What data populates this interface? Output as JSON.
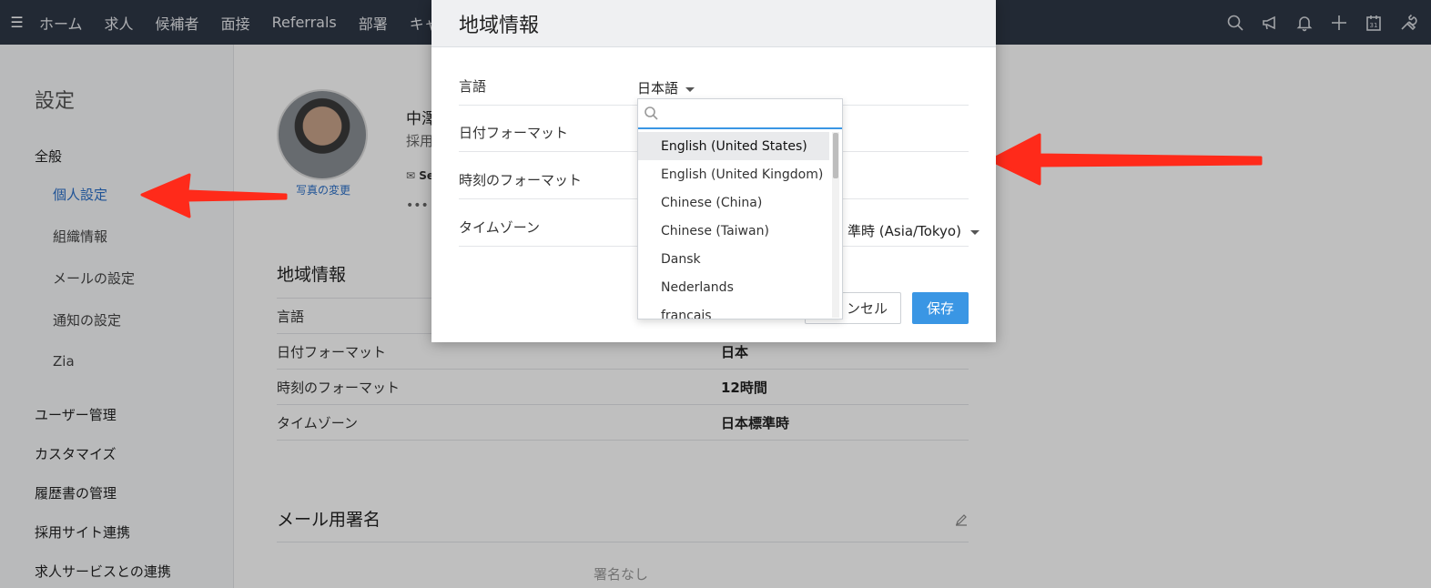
{
  "nav": {
    "items": [
      "ホーム",
      "求人",
      "候補者",
      "面接",
      "Referrals",
      "部署",
      "キャ"
    ],
    "icons": [
      "search-icon",
      "megaphone-icon",
      "bell-icon",
      "plus-icon",
      "calendar-icon",
      "tools-icon"
    ],
    "calendar_day": "31"
  },
  "sidebar": {
    "title": "設定",
    "general": "全般",
    "items": [
      "個人設定",
      "組織情報",
      "メールの設定",
      "通知の設定",
      "Zia"
    ],
    "sections": [
      "ユーザー管理",
      "カスタマイズ",
      "履歴書の管理",
      "採用サイト連携",
      "求人サービスとの連携"
    ]
  },
  "profile": {
    "photo_change": "写真の変更",
    "name": "中澤",
    "role": "採用",
    "mail": "Se",
    "more": "•••"
  },
  "locale_section": {
    "title": "地域情報",
    "rows": [
      {
        "label": "言語",
        "value": ""
      },
      {
        "label": "日付フォーマット",
        "value": "日本"
      },
      {
        "label": "時刻のフォーマット",
        "value": "12時間"
      },
      {
        "label": "タイムゾーン",
        "value": "日本標準時"
      }
    ]
  },
  "signature_section": {
    "title": "メール用署名",
    "empty": "署名なし"
  },
  "modal": {
    "title": "地域情報",
    "labels": [
      "言語",
      "日付フォーマット",
      "時刻のフォーマット",
      "タイムゾーン"
    ],
    "language_value": "日本語",
    "timezone_value": "準時 (Asia/Tokyo)",
    "cancel": "ンセル",
    "save": "保存"
  },
  "dropdown": {
    "search_placeholder": "",
    "options": [
      "English (United States)",
      "English (United Kingdom)",
      "Chinese (China)",
      "Chinese (Taiwan)",
      "Dansk",
      "Nederlands",
      "français"
    ],
    "highlighted": 0
  },
  "colors": {
    "topbar": "#2e3746",
    "accent": "#3a96e4",
    "link": "#2a6fc9",
    "annotation": "#ff2a1a"
  }
}
